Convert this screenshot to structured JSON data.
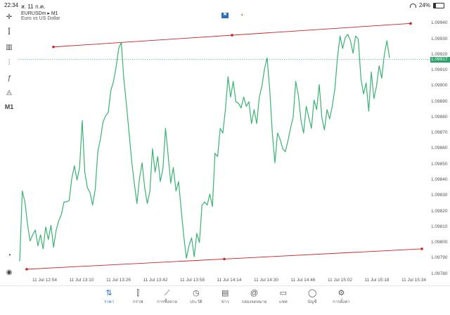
{
  "status": {
    "time": "22:34",
    "date": "ส. 11 ก.ค.",
    "battery": "24%"
  },
  "symbol": {
    "name": "EURUSDm",
    "timeframe": "M1",
    "description": "Euro vs US Dollar"
  },
  "toolbar": {
    "timeframe_label": "M1"
  },
  "price_axis": {
    "labels": [
      "1.09940",
      "1.09930",
      "1.09920",
      "1.09910",
      "1.09900",
      "1.09890",
      "1.09880",
      "1.09870",
      "1.09860",
      "1.09850",
      "1.09840",
      "1.09830",
      "1.09820",
      "1.09810",
      "1.09800",
      "1.09790",
      "1.09780"
    ],
    "current_price": "1.09917"
  },
  "time_axis": {
    "labels": [
      "11 Jul 12:54",
      "11 Jul 13:10",
      "11 Jul 13:26",
      "11 Jul 13:42",
      "11 Jul 13:58",
      "11 Jul 14:14",
      "11 Jul 14:30",
      "11 Jul 14:46",
      "11 Jul 15:02",
      "11 Jul 15:18",
      "11 Jul 15:34"
    ]
  },
  "chart_data": {
    "type": "line",
    "series": [
      {
        "color": "#3bb273",
        "values": [
          1.09788,
          1.09833,
          1.09826,
          1.09812,
          1.09801,
          1.09805,
          1.09808,
          1.09798,
          1.09805,
          1.09796,
          1.0981,
          1.09802,
          1.09811,
          1.09797,
          1.09808,
          1.09814,
          1.09818,
          1.09826,
          1.09826,
          1.09827,
          1.09841,
          1.09849,
          1.0984,
          1.09848,
          1.09878,
          1.09845,
          1.09835,
          1.09832,
          1.09824,
          1.09834,
          1.09858,
          1.09866,
          1.09877,
          1.09881,
          1.09883,
          1.09897,
          1.09903,
          1.09912,
          1.09924,
          1.09928,
          1.09904,
          1.09888,
          1.0987,
          1.09852,
          1.09838,
          1.09825,
          1.09841,
          1.09851,
          1.09835,
          1.09825,
          1.09833,
          1.0986,
          1.09845,
          1.09855,
          1.09839,
          1.09847,
          1.09873,
          1.09856,
          1.09838,
          1.09848,
          1.09833,
          1.09839,
          1.09821,
          1.09804,
          1.0979,
          1.09798,
          1.09803,
          1.09791,
          1.09806,
          1.098,
          1.09824,
          1.09826,
          1.09824,
          1.09831,
          1.09823,
          1.09857,
          1.09855,
          1.09873,
          1.0987,
          1.09885,
          1.09906,
          1.09893,
          1.09903,
          1.0989,
          1.09889,
          1.09886,
          1.09893,
          1.09887,
          1.0989,
          1.09876,
          1.09885,
          1.09876,
          1.09893,
          1.099,
          1.09911,
          1.09918,
          1.09898,
          1.0987,
          1.09851,
          1.0987,
          1.09866,
          1.0986,
          1.09858,
          1.09865,
          1.09873,
          1.0988,
          1.09903,
          1.09894,
          1.09878,
          1.0987,
          1.09887,
          1.0988,
          1.09873,
          1.09891,
          1.09885,
          1.09901,
          1.0988,
          1.09872,
          1.09885,
          1.09879,
          1.09887,
          1.09898,
          1.09918,
          1.09932,
          1.09924,
          1.09931,
          1.09933,
          1.09929,
          1.09921,
          1.09932,
          1.0993,
          1.09905,
          1.09895,
          1.09902,
          1.09884,
          1.09909,
          1.09892,
          1.099,
          1.09913,
          1.09905,
          1.0992,
          1.09929,
          1.09918
        ],
        "ylim": [
          1.09778,
          1.09946
        ]
      }
    ],
    "trendlines": [
      {
        "color": "#cc2222",
        "from": [
          1.09925
        ],
        "to": [
          1.0994
        ]
      },
      {
        "color": "#cc2222",
        "from": [
          1.09783
        ],
        "to": [
          1.09796
        ]
      }
    ],
    "current_price": 1.09917
  },
  "tabs": [
    {
      "label": "ราคา",
      "icon": "quotes-icon"
    },
    {
      "label": "กราฟ",
      "icon": "chart-icon"
    },
    {
      "label": "การซื้อขาย",
      "icon": "trade-icon"
    },
    {
      "label": "ประวัติ",
      "icon": "history-icon"
    },
    {
      "label": "ข่าว",
      "icon": "news-icon"
    },
    {
      "label": "กล่องจดหมาย",
      "icon": "mailbox-icon"
    },
    {
      "label": "แชท",
      "icon": "chat-icon"
    },
    {
      "label": "บัญชี",
      "icon": "account-icon"
    },
    {
      "label": "การตั้งค่า",
      "icon": "settings-icon"
    }
  ],
  "active_tab": "ราคา"
}
